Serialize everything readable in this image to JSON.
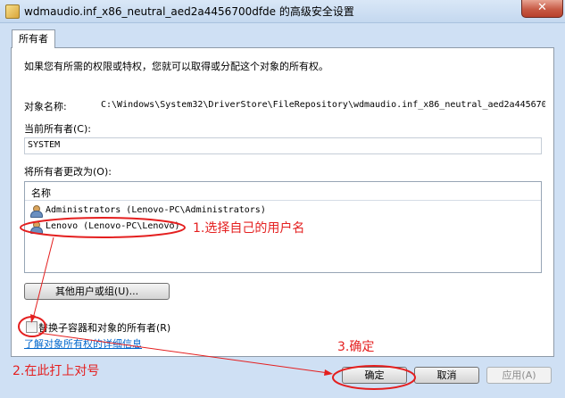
{
  "window": {
    "title": "wdmaudio.inf_x86_neutral_aed2a4456700dfde 的高级安全设置",
    "close_glyph": "✕"
  },
  "tabs": [
    {
      "label": "所有者"
    }
  ],
  "owner": {
    "intro": "如果您有所需的权限或特权，您就可以取得或分配这个对象的所有权。",
    "object_name_label": "对象名称:",
    "object_name_value": "C:\\Windows\\System32\\DriverStore\\FileRepository\\wdmaudio.inf_x86_neutral_aed2a445670",
    "current_owner_label": "当前所有者(C):",
    "current_owner_value": "SYSTEM",
    "change_owner_label": "将所有者更改为(O):",
    "list_header": "名称",
    "list_items": [
      {
        "name": "Administrators (Lenovo-PC\\Administrators)",
        "icon": "user-group-icon"
      },
      {
        "name": "Lenovo (Lenovo-PC\\Lenovo)",
        "icon": "user-icon"
      }
    ],
    "other_users_button": "其他用户或组(U)...",
    "replace_checkbox_label": "替换子容器和对象的所有者(R)",
    "replace_checked": false,
    "learn_more_link": "了解对象所有权的详细信息"
  },
  "buttons": {
    "ok": "确定",
    "cancel": "取消",
    "apply": "应用(A)"
  },
  "annotations": {
    "step1": "1.选择自己的用户名",
    "step2": "2.在此打上对号",
    "step3": "3.确定",
    "color": "#e41f1f"
  }
}
